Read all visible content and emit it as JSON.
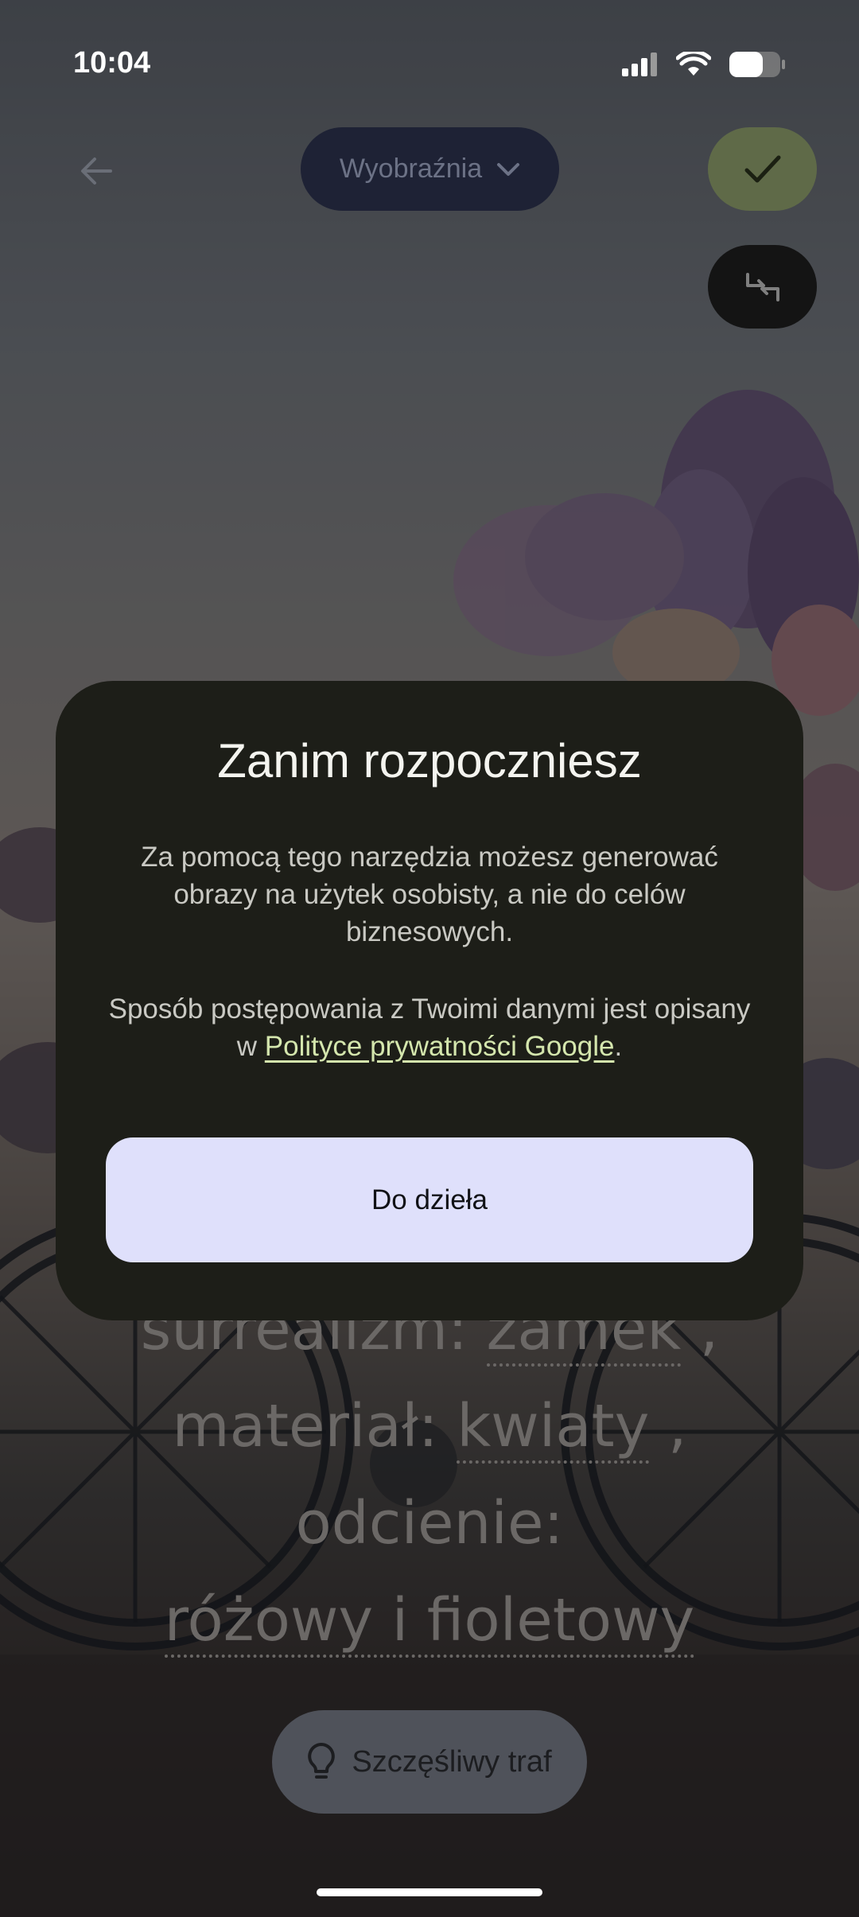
{
  "status_bar": {
    "time": "10:04"
  },
  "top_bar": {
    "model_dropdown_label": "Wyobraźnia"
  },
  "prompt": {
    "lines": [
      {
        "parts": [
          "surrealizm: ",
          "zamek",
          " ,"
        ]
      },
      {
        "parts": [
          "materiał: ",
          "kwiaty",
          " ,"
        ]
      },
      {
        "parts": [
          "odcienie:"
        ]
      },
      {
        "parts": [
          "różowy i fioletowy"
        ]
      }
    ],
    "line1_label": "surrealizm: ",
    "line1_value": "zamek",
    "line1_sep": " ,",
    "line2_label": "materiał: ",
    "line2_value": "kwiaty",
    "line2_sep": " ,",
    "line3_label": "odcienie:",
    "line4_value": "różowy i fioletowy"
  },
  "lucky_button": {
    "label": "Szczęśliwy traf"
  },
  "dialog": {
    "title": "Zanim rozpoczniesz",
    "paragraph1": "Za pomocą tego narzędzia możesz generować obrazy na użytek osobisty, a nie do celów biznesowych.",
    "paragraph2_prefix": "Sposób postępowania z Twoimi danymi jest opisany w ",
    "privacy_link_text": "Polityce prywatności Google",
    "paragraph2_suffix": ".",
    "primary_button_label": "Do dzieła"
  },
  "colors": {
    "dialog_bg": "#1d1e18",
    "primary_button_bg": "#dfe0fb",
    "link": "#d4e6ad",
    "confirm_bg": "#5f6a48",
    "dropdown_bg": "#1e2235"
  },
  "icons": {
    "back": "arrow-left-icon",
    "dropdown": "chevron-down-icon",
    "confirm": "checkmark-icon",
    "swap": "swap-icon",
    "lucky": "lightbulb-icon",
    "signal": "signal-icon",
    "wifi": "wifi-icon",
    "battery": "battery-icon"
  }
}
